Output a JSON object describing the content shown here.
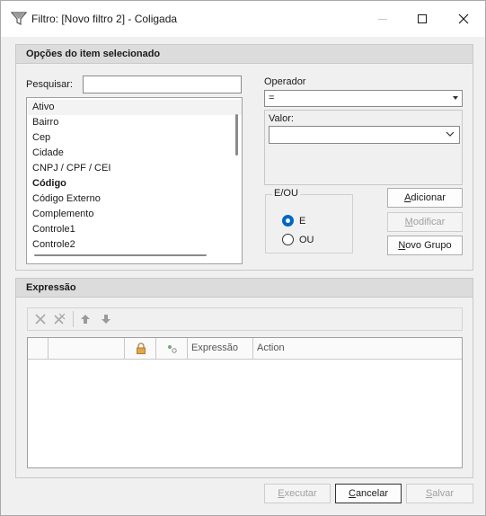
{
  "window": {
    "title": "Filtro: [Novo filtro 2] - Coligada",
    "minimize_icon": "minimize-icon",
    "maximize_icon": "maximize-icon",
    "close_icon": "close-icon"
  },
  "options_panel": {
    "header": "Opções do item selecionado",
    "search_label": "Pesquisar:",
    "search_value": "",
    "items": [
      {
        "label": "Ativo",
        "bold": false,
        "selected": true
      },
      {
        "label": "Bairro",
        "bold": false
      },
      {
        "label": "Cep",
        "bold": false
      },
      {
        "label": "Cidade",
        "bold": false
      },
      {
        "label": "CNPJ / CPF / CEI",
        "bold": false
      },
      {
        "label": "Código",
        "bold": true
      },
      {
        "label": "Código Externo",
        "bold": false
      },
      {
        "label": "Complemento",
        "bold": false
      },
      {
        "label": "Controle1",
        "bold": false
      },
      {
        "label": "Controle2",
        "bold": false
      }
    ],
    "operator_label": "Operador",
    "operator_value": "=",
    "value_label": "Valor:",
    "value_value": "",
    "logic_group_title": "E/OU",
    "logic_options": [
      {
        "label": "E",
        "checked": true
      },
      {
        "label": "OU",
        "checked": false
      }
    ],
    "buttons": {
      "add": {
        "label": "Adicionar",
        "underline": "A",
        "rest": "dicionar",
        "enabled": true
      },
      "modify": {
        "label": "Modificar",
        "underline": "M",
        "rest": "odificar",
        "enabled": false
      },
      "new_group": {
        "label": "Novo Grupo",
        "underline": "N",
        "rest": "ovo Grupo",
        "enabled": true
      }
    }
  },
  "expression_panel": {
    "header": "Expressão",
    "toolbar_icons": [
      "delete-icon",
      "delete-all-icon",
      "move-up-icon",
      "move-down-icon"
    ],
    "columns": [
      "",
      "",
      "lock-icon",
      "link-icon",
      "Expressão",
      "Action"
    ],
    "column_labels": {
      "expression": "Expressão",
      "action": "Action"
    },
    "rows": []
  },
  "footer": {
    "execute": {
      "label": "Executar",
      "underline": "E",
      "rest": "xecutar",
      "enabled": false
    },
    "cancel": {
      "label": "Cancelar",
      "underline": "C",
      "rest": "ancelar",
      "enabled": true
    },
    "save": {
      "label": "Salvar",
      "underline": "S",
      "rest": "alvar",
      "enabled": false
    }
  },
  "colors": {
    "accent": "#0067c0",
    "panel_header": "#dcdcdc",
    "window_bg": "#f0f0f0",
    "disabled_text": "#a0a0a0"
  }
}
